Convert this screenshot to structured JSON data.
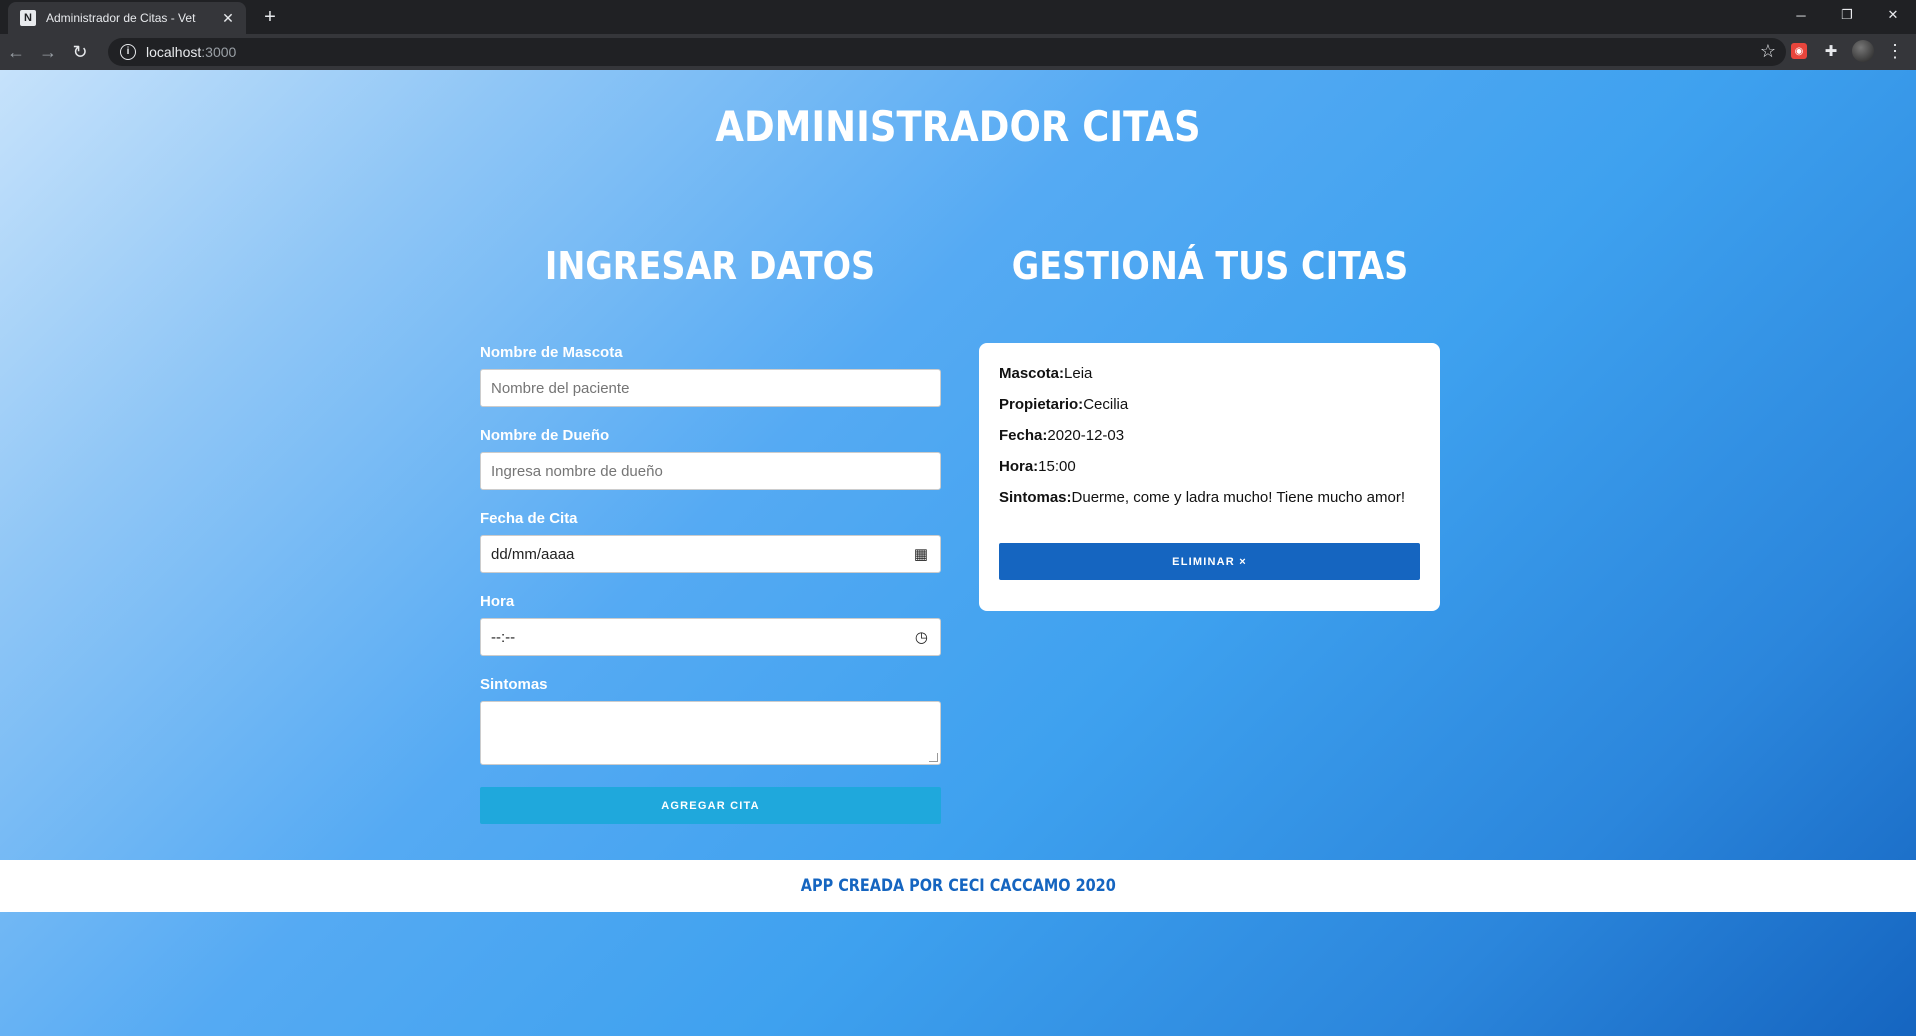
{
  "browser": {
    "tab_title": "Administrador de Citas - Vet",
    "tab_close": "✕",
    "new_tab": "+",
    "url_host": "localhost",
    "url_port": ":3000",
    "minimize": "─",
    "restore": "❐",
    "close": "✕"
  },
  "app": {
    "title": "ADMINISTRADOR CITAS"
  },
  "form": {
    "heading": "INGRESAR DATOS",
    "mascota_label": "Nombre de Mascota",
    "mascota_placeholder": "Nombre del paciente",
    "dueno_label": "Nombre de Dueño",
    "dueno_placeholder": "Ingresa nombre de dueño",
    "fecha_label": "Fecha de Cita",
    "fecha_value": "dd/mm/aaaa",
    "hora_label": "Hora",
    "hora_value": "--:--",
    "sintomas_label": "Sintomas",
    "submit_label": "AGREGAR CITA"
  },
  "citas": {
    "heading": "GESTIONÁ TUS CITAS",
    "items": [
      {
        "mascota_label": "Mascota:",
        "mascota": "Leia",
        "propietario_label": "Propietario:",
        "propietario": "Cecilia",
        "fecha_label": "Fecha:",
        "fecha": "2020-12-03",
        "hora_label": "Hora:",
        "hora": "15:00",
        "sintomas_label": "Sintomas:",
        "sintomas": "Duerme, come y ladra mucho! Tiene mucho amor!",
        "delete_label": "ELIMINAR ×"
      }
    ]
  },
  "footer": {
    "text": "APP CREADA POR CECI CACCAMO 2020"
  },
  "colors": {
    "primary": "#1565c0",
    "accent": "#1fa8dc",
    "gradient_start": "#c6e2fb",
    "gradient_end": "#1565c0"
  }
}
